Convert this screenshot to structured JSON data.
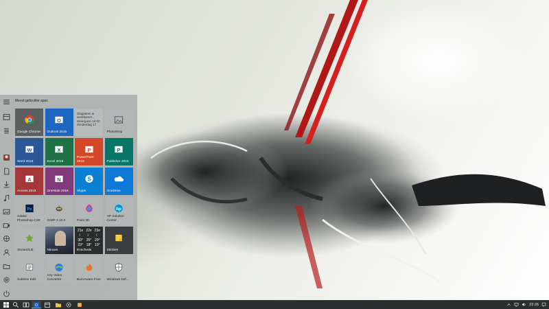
{
  "start_menu": {
    "list_header": "Meest gebruikte apps",
    "tiles": [
      {
        "label": "Google Chrome",
        "icon": "chrome-icon",
        "bg": "#5a5f60"
      },
      {
        "label": "Outlook 2016",
        "icon": "outlook-icon",
        "bg": "#1d66c1"
      },
      {
        "label": "",
        "icon": "mail-icon",
        "bg": "#b8bcbd",
        "light": true,
        "sub": "Stagiairen & werkkamer...\nWeergave 13:00\ndonderdag 17"
      },
      {
        "label": "Photoshop",
        "icon": "photos-icon",
        "bg": "#b2b6b7",
        "light": true
      },
      {
        "label": "Word 2016",
        "icon": "word-icon",
        "bg": "#2b5797"
      },
      {
        "label": "Excel 2016",
        "icon": "excel-icon",
        "bg": "#1e7145"
      },
      {
        "label": "PowerPoint\n2016",
        "icon": "powerpoint-icon",
        "bg": "#d24726"
      },
      {
        "label": "Publisher 2016",
        "icon": "publisher-icon",
        "bg": "#077568"
      },
      {
        "label": "Access 2016",
        "icon": "access-icon",
        "bg": "#a4373a"
      },
      {
        "label": "OneNote 2016",
        "icon": "onenote-icon",
        "bg": "#80397b"
      },
      {
        "label": "Skype",
        "icon": "skype-icon",
        "bg": "#0a7fd4"
      },
      {
        "label": "OneDrive",
        "icon": "onedrive-icon",
        "bg": "#0e78d7"
      },
      {
        "label": "Adobe\nPhotoshop CS6",
        "icon": "photoshop-icon",
        "bg": "#b2b6b7",
        "light": true
      },
      {
        "label": "GIMP 2.10.0",
        "icon": "gimp-icon",
        "bg": "#b2b6b7",
        "light": true
      },
      {
        "label": "Paint 3D",
        "icon": "paint3d-icon",
        "bg": "#b2b6b7",
        "light": true
      },
      {
        "label": "HP Solution\nCenter",
        "icon": "hp-icon",
        "bg": "#b2b6b7",
        "light": true
      },
      {
        "label": "Streamhub",
        "icon": "streamhub-icon",
        "bg": "#b2b6b7",
        "light": true
      },
      {
        "label": "Nieuws",
        "icon": "news-icon",
        "bg": "#3a3e40"
      },
      {
        "label": "Enschede",
        "icon": "weather-icon",
        "bg": "#2a2d2e",
        "weather": {
          "days": [
            "21e",
            "22e",
            "23e"
          ],
          "icons": [
            "☾",
            "☾",
            "☾"
          ],
          "temps": [
            "30°",
            "25°",
            "29°"
          ],
          "lows": [
            "23°",
            "18°",
            "19°"
          ]
        }
      },
      {
        "label": "Stickies",
        "icon": "stickies-icon",
        "bg": "#3a3e40"
      },
      {
        "label": "Sublime Edit",
        "icon": "sublime-icon",
        "bg": "#b2b6b7",
        "light": true
      },
      {
        "label": "Any Video\nConverter",
        "icon": "video-converter-icon",
        "bg": "#b2b6b7",
        "light": true
      },
      {
        "label": "BurnAware Free",
        "icon": "burnaware-icon",
        "bg": "#b2b6b7",
        "light": true
      },
      {
        "label": "Windows Def...",
        "icon": "shield-icon",
        "bg": "#b2b6b7",
        "light": true
      }
    ]
  },
  "taskbar": {
    "clock": "23:26",
    "tray_icons": [
      "chevron-up-icon",
      "network-icon",
      "volume-icon",
      "notification-icon"
    ]
  },
  "colors": {
    "taskbar": "#2c2f30",
    "start_bg": "#acb2b0"
  }
}
